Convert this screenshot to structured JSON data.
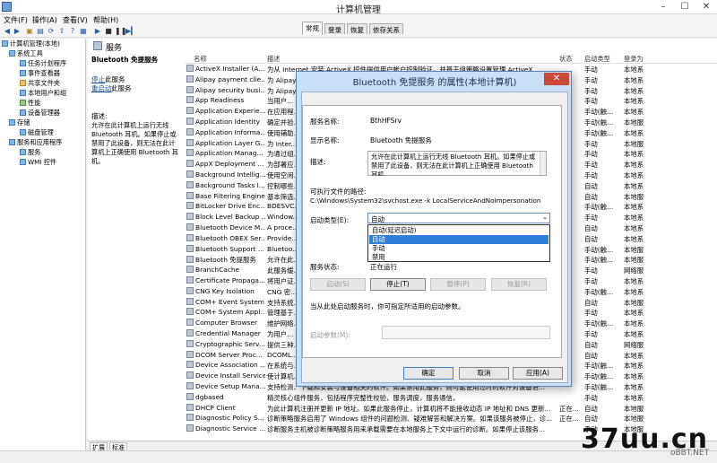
{
  "window": {
    "title": "计算机管理"
  },
  "menu": [
    "文件(F)",
    "操作(A)",
    "查看(V)",
    "帮助(H)"
  ],
  "tree": [
    {
      "label": "计算机管理(本地)",
      "level": 0
    },
    {
      "label": "系统工具",
      "level": 1
    },
    {
      "label": "任务计划程序",
      "level": 2
    },
    {
      "label": "事件查看器",
      "level": 2
    },
    {
      "label": "共享文件夹",
      "level": 2
    },
    {
      "label": "本地用户和组",
      "level": 2
    },
    {
      "label": "性能",
      "level": 2
    },
    {
      "label": "设备管理器",
      "level": 2
    },
    {
      "label": "存储",
      "level": 1
    },
    {
      "label": "磁盘管理",
      "level": 2
    },
    {
      "label": "服务和应用程序",
      "level": 1
    },
    {
      "label": "服务",
      "level": 2
    },
    {
      "label": "WMI 控件",
      "level": 2
    }
  ],
  "header": {
    "title": "服务"
  },
  "left_panel": {
    "service_title": "Bluetooth 免提服务",
    "stop_link": "停止",
    "stop_suffix": "此服务",
    "restart_link": "重启动",
    "restart_suffix": "此服务",
    "desc_label": "描述:",
    "desc_text": "允许在此计算机上运行无线 Bluetooth 耳机。如果停止或禁用了此设备，则无法在此计算机上正确使用 Bluetooth 耳机。"
  },
  "columns": {
    "name": "名称",
    "description": "描述",
    "status": "状态",
    "startup": "启动类型",
    "logon": "登录为"
  },
  "services": [
    {
      "name": "ActiveX Installer (A...",
      "desc": "为从 Internet 安装 ActiveX 控件提供用户帐户控制验证，并基于组策略设置管理 ActiveX ...",
      "status": "",
      "startup": "手动",
      "logon": "本地系"
    },
    {
      "name": "Alipay payment clie...",
      "desc": "为 Alipay...",
      "status": "",
      "startup": "手动",
      "logon": "本地系"
    },
    {
      "name": "Alipay security busi...",
      "desc": "为 Alipay...",
      "status": "",
      "startup": "手动",
      "logon": "本地系"
    },
    {
      "name": "App Readiness",
      "desc": "当用户...",
      "status": "",
      "startup": "手动",
      "logon": "本地系"
    },
    {
      "name": "Application Experie...",
      "desc": "在应用程...",
      "status": "",
      "startup": "手动(触...",
      "logon": "本地系"
    },
    {
      "name": "Application Identity",
      "desc": "确定并验...",
      "status": "",
      "startup": "手动(触...",
      "logon": "本地服"
    },
    {
      "name": "Application Informa...",
      "desc": "使用辅助...",
      "status": "",
      "startup": "手动(触...",
      "logon": "本地系"
    },
    {
      "name": "Application Layer G...",
      "desc": "为 Inter...",
      "status": "",
      "startup": "手动",
      "logon": "本地服"
    },
    {
      "name": "Application Manag...",
      "desc": "为通过组...",
      "status": "",
      "startup": "手动",
      "logon": "本地系"
    },
    {
      "name": "AppX Deployment ...",
      "desc": "为部署应...",
      "status": "",
      "startup": "手动",
      "logon": "本地系"
    },
    {
      "name": "Background Intellig...",
      "desc": "使用空闲...",
      "status": "",
      "startup": "手动",
      "logon": "本地系"
    },
    {
      "name": "Background Tasks I...",
      "desc": "控制哪些...",
      "status": "",
      "startup": "自动",
      "logon": "本地系"
    },
    {
      "name": "Base Filtering Engine",
      "desc": "基本筛选...",
      "status": "",
      "startup": "自动",
      "logon": "本地服"
    },
    {
      "name": "BitLocker Drive Enc...",
      "desc": "BDESVC...",
      "status": "",
      "startup": "手动(触...",
      "logon": "本地系"
    },
    {
      "name": "Block Level Backup ...",
      "desc": "Window...",
      "status": "",
      "startup": "手动",
      "logon": "本地系"
    },
    {
      "name": "Bluetooth Device M...",
      "desc": "A proce...",
      "status": "",
      "startup": "自动",
      "logon": "本地系"
    },
    {
      "name": "Bluetooth OBEX Ser...",
      "desc": "Provide...",
      "status": "",
      "startup": "自动",
      "logon": "本地系"
    },
    {
      "name": "Bluetooth Support ...",
      "desc": "Bluetoo...",
      "status": "",
      "startup": "手动(触...",
      "logon": "本地服"
    },
    {
      "name": "Bluetooth 免提服务",
      "desc": "允许在此...",
      "status": "",
      "startup": "手动(触...",
      "logon": "本地服"
    },
    {
      "name": "BranchCache",
      "desc": "此服务缓...",
      "status": "",
      "startup": "手动",
      "logon": "网络服"
    },
    {
      "name": "Certificate Propaga...",
      "desc": "将用户证...",
      "status": "",
      "startup": "手动",
      "logon": "本地系"
    },
    {
      "name": "CNG Key Isolation",
      "desc": "CNG 密...",
      "status": "",
      "startup": "手动(触...",
      "logon": "本地系"
    },
    {
      "name": "COM+ Event System",
      "desc": "支持系统...",
      "status": "",
      "startup": "自动",
      "logon": "本地服"
    },
    {
      "name": "COM+ System Appl...",
      "desc": "管理基于...",
      "status": "",
      "startup": "手动",
      "logon": "本地系"
    },
    {
      "name": "Computer Browser",
      "desc": "维护网络...",
      "status": "",
      "startup": "手动(触...",
      "logon": "本地系"
    },
    {
      "name": "Credential Manager",
      "desc": "为用户...",
      "status": "",
      "startup": "手动",
      "logon": "本地系"
    },
    {
      "name": "Cryptographic Serv...",
      "desc": "提供三种...",
      "status": "",
      "startup": "自动",
      "logon": "网络服"
    },
    {
      "name": "DCOM Server Proc...",
      "desc": "DCOML...",
      "status": "",
      "startup": "自动",
      "logon": "本地系"
    },
    {
      "name": "Device Association ...",
      "desc": "在系统与...",
      "status": "",
      "startup": "手动(触...",
      "logon": "本地系"
    },
    {
      "name": "Device Install Service",
      "desc": "使计算机...",
      "status": "",
      "startup": "手动(触...",
      "logon": "本地系"
    },
    {
      "name": "Device Setup Mana...",
      "desc": "支持检测、下载和安装与设备相关的软件。如果禁用此服务，则可能使用过时的软件对设备进...",
      "status": "",
      "startup": "手动(触...",
      "logon": "本地系"
    },
    {
      "name": "dgbased",
      "desc": "精灵核心组件服务，包括程序完整性校验，服务调度，服务通信。",
      "status": "",
      "startup": "手动",
      "logon": "本地系"
    },
    {
      "name": "DHCP Client",
      "desc": "为此计算机注册并更新 IP 地址。如果此服务停止，计算机将不能接收动态 IP 地址和 DNS 更新...",
      "status": "正在...",
      "startup": "自动",
      "logon": "本地服"
    },
    {
      "name": "Diagnostic Policy S...",
      "desc": "诊断策略服务启用了 Windows 组件的问题检测、疑难解答和解决方案。如果该服务被停止，诊...",
      "status": "正在...",
      "startup": "自动",
      "logon": "本地服"
    },
    {
      "name": "Diagnostic Service ...",
      "desc": "诊断服务主机被诊断策略服务用来承载需要在本地服务上下文中运行的诊断。如果停止该服务...",
      "status": "",
      "startup": "手动",
      "logon": "本地服"
    }
  ],
  "bottom_tabs": [
    "扩展",
    "标准"
  ],
  "dialog": {
    "title": "Bluetooth 免提服务 的属性(本地计算机)",
    "close": "✕",
    "tabs": [
      "常规",
      "登录",
      "恢复",
      "依存关系"
    ],
    "service_name_label": "服务名称:",
    "service_name": "BthHFSrv",
    "display_name_label": "显示名称:",
    "display_name": "Bluetooth 免提服务",
    "desc_label": "描述:",
    "desc": "允许在此计算机上运行无线 Bluetooth 耳机。如果停止或禁用了此设备，则无法在此计算机上正确使用 Bluetooth 耳机。",
    "path_label": "可执行文件的路径:",
    "path": "C:\\Windows\\System32\\svchost.exe -k LocalServiceAndNoImpersonation",
    "startup_label": "启动类型(E):",
    "startup_value": "自动",
    "startup_options": [
      "自动(延迟启动)",
      "自动",
      "手动",
      "禁用"
    ],
    "status_label": "服务状态:",
    "status_value": "正在运行",
    "btn_start": "启动(S)",
    "btn_stop": "停止(T)",
    "btn_pause": "暂停(P)",
    "btn_resume": "恢复(R)",
    "hint": "当从此处启动服务时，你可指定所适用的启动参数。",
    "params_label": "启动参数(M):",
    "ok": "确定",
    "cancel": "取消",
    "apply": "应用(A)"
  },
  "watermark": {
    "main": "37uu.cn",
    "sub": "oBBT.NET"
  }
}
